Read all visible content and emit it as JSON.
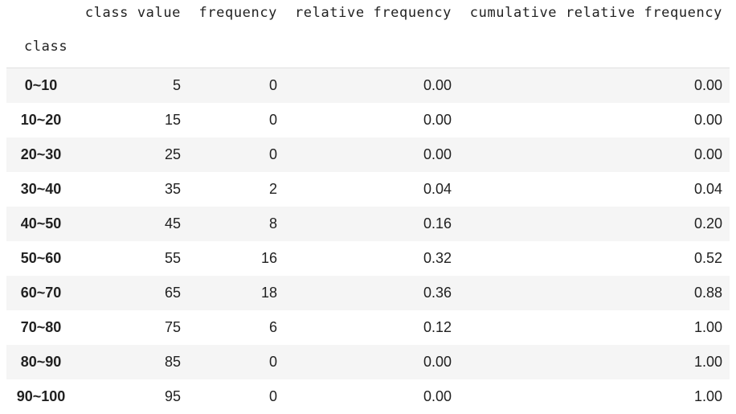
{
  "table": {
    "columns": [
      "class value",
      "frequency",
      "relative frequency",
      "cumulative relative frequency"
    ],
    "index_name": "class",
    "rows": [
      {
        "class": "0~10",
        "class_value": "5",
        "frequency": "0",
        "relative_frequency": "0.00",
        "cumulative_relative_frequency": "0.00"
      },
      {
        "class": "10~20",
        "class_value": "15",
        "frequency": "0",
        "relative_frequency": "0.00",
        "cumulative_relative_frequency": "0.00"
      },
      {
        "class": "20~30",
        "class_value": "25",
        "frequency": "0",
        "relative_frequency": "0.00",
        "cumulative_relative_frequency": "0.00"
      },
      {
        "class": "30~40",
        "class_value": "35",
        "frequency": "2",
        "relative_frequency": "0.04",
        "cumulative_relative_frequency": "0.04"
      },
      {
        "class": "40~50",
        "class_value": "45",
        "frequency": "8",
        "relative_frequency": "0.16",
        "cumulative_relative_frequency": "0.20"
      },
      {
        "class": "50~60",
        "class_value": "55",
        "frequency": "16",
        "relative_frequency": "0.32",
        "cumulative_relative_frequency": "0.52"
      },
      {
        "class": "60~70",
        "class_value": "65",
        "frequency": "18",
        "relative_frequency": "0.36",
        "cumulative_relative_frequency": "0.88"
      },
      {
        "class": "70~80",
        "class_value": "75",
        "frequency": "6",
        "relative_frequency": "0.12",
        "cumulative_relative_frequency": "1.00"
      },
      {
        "class": "80~90",
        "class_value": "85",
        "frequency": "0",
        "relative_frequency": "0.00",
        "cumulative_relative_frequency": "1.00"
      },
      {
        "class": "90~100",
        "class_value": "95",
        "frequency": "0",
        "relative_frequency": "0.00",
        "cumulative_relative_frequency": "1.00"
      }
    ]
  }
}
